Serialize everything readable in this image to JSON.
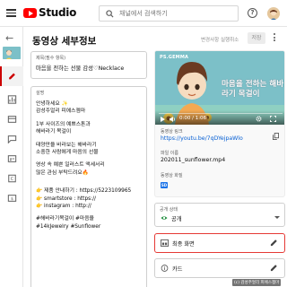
{
  "header": {
    "app_name": "Studio",
    "search_placeholder": "채널에서 검색하기",
    "undo_label": "변경사항 실행취소",
    "save_label": "저장"
  },
  "page": {
    "title": "동영상 세부정보"
  },
  "title_field": {
    "label": "제목(필수 항목)",
    "value": "마음을 전하는 선물 감성♡Necklace"
  },
  "description": {
    "label": "설명",
    "lines": [
      "안녕하세요 ✨",
      "감성주얼리 피에스젬마 ",
      "",
      "1부 사이즈의 예쁘스톤과",
      "해바라기 목걸이",
      "",
      "태양만을 바라보는 해바라기",
      "소중한 사람에게 마음의 선물",
      "",
      "영상 속 예쁜 일러스트 액세서리",
      "많은 관심 부탁드려요🔥",
      "",
      "",
      "👉 제품 안내하기 : https://5223109965",
      "👉 smartstore : https://",
      "👉 instagram : http://",
      "",
      "#해바라기목걸이 #마음을",
      "#14kJewelry #Sunflower"
    ]
  },
  "video": {
    "overlay_brand": "PS.GEMMA",
    "caption": "마음을 전하는 해바라기 목걸이",
    "time": "0:00 / 1:06"
  },
  "meta": {
    "link_label": "동영상 링크",
    "link_value": "https://youtu.be/7qDYejpaWlo",
    "filename_label": "파일 이름",
    "filename_value": "202011_sunflower.mp4",
    "quality_label": "동영상 화질",
    "quality_badge": "SD"
  },
  "visibility": {
    "label": "공개 상태",
    "value": "공개"
  },
  "options": {
    "end_screen": "최종 화면",
    "cards": "카드"
  },
  "watermark": "(c) 감성주얼리 피에스젬마",
  "colors": {
    "brand_red": "#ff0000",
    "link_blue": "#065fd4",
    "highlight_red": "#e53935"
  }
}
